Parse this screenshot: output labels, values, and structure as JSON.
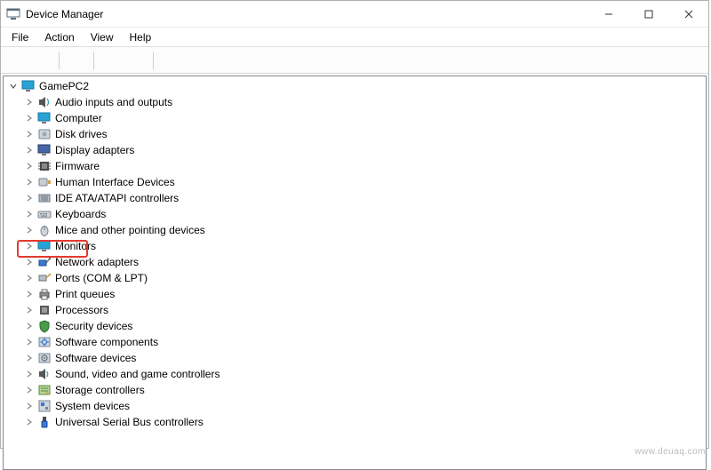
{
  "window": {
    "title": "Device Manager"
  },
  "menu": {
    "file": "File",
    "action": "Action",
    "view": "View",
    "help": "Help"
  },
  "toolbar": {
    "back": "back-icon",
    "forward": "forward-icon",
    "show_hidden": "show-hidden-icon",
    "help": "help-icon",
    "properties": "properties-icon",
    "scan": "scan-icon"
  },
  "tree": {
    "root": "GamePC2",
    "items": [
      {
        "label": "Audio inputs and outputs",
        "icon": "speaker"
      },
      {
        "label": "Computer",
        "icon": "monitor"
      },
      {
        "label": "Disk drives",
        "icon": "disk"
      },
      {
        "label": "Display adapters",
        "icon": "display"
      },
      {
        "label": "Firmware",
        "icon": "chip"
      },
      {
        "label": "Human Interface Devices",
        "icon": "hid"
      },
      {
        "label": "IDE ATA/ATAPI controllers",
        "icon": "ide"
      },
      {
        "label": "Keyboards",
        "icon": "keyboard"
      },
      {
        "label": "Mice and other pointing devices",
        "icon": "mouse"
      },
      {
        "label": "Monitors",
        "icon": "monitor",
        "highlighted": true
      },
      {
        "label": "Network adapters",
        "icon": "network"
      },
      {
        "label": "Ports (COM & LPT)",
        "icon": "port"
      },
      {
        "label": "Print queues",
        "icon": "printer"
      },
      {
        "label": "Processors",
        "icon": "cpu"
      },
      {
        "label": "Security devices",
        "icon": "shield"
      },
      {
        "label": "Software components",
        "icon": "swcomp"
      },
      {
        "label": "Software devices",
        "icon": "swdev"
      },
      {
        "label": "Sound, video and game controllers",
        "icon": "sound"
      },
      {
        "label": "Storage controllers",
        "icon": "storage"
      },
      {
        "label": "System devices",
        "icon": "system"
      },
      {
        "label": "Universal Serial Bus controllers",
        "icon": "usb"
      }
    ]
  },
  "watermark": "www.deuaq.com"
}
